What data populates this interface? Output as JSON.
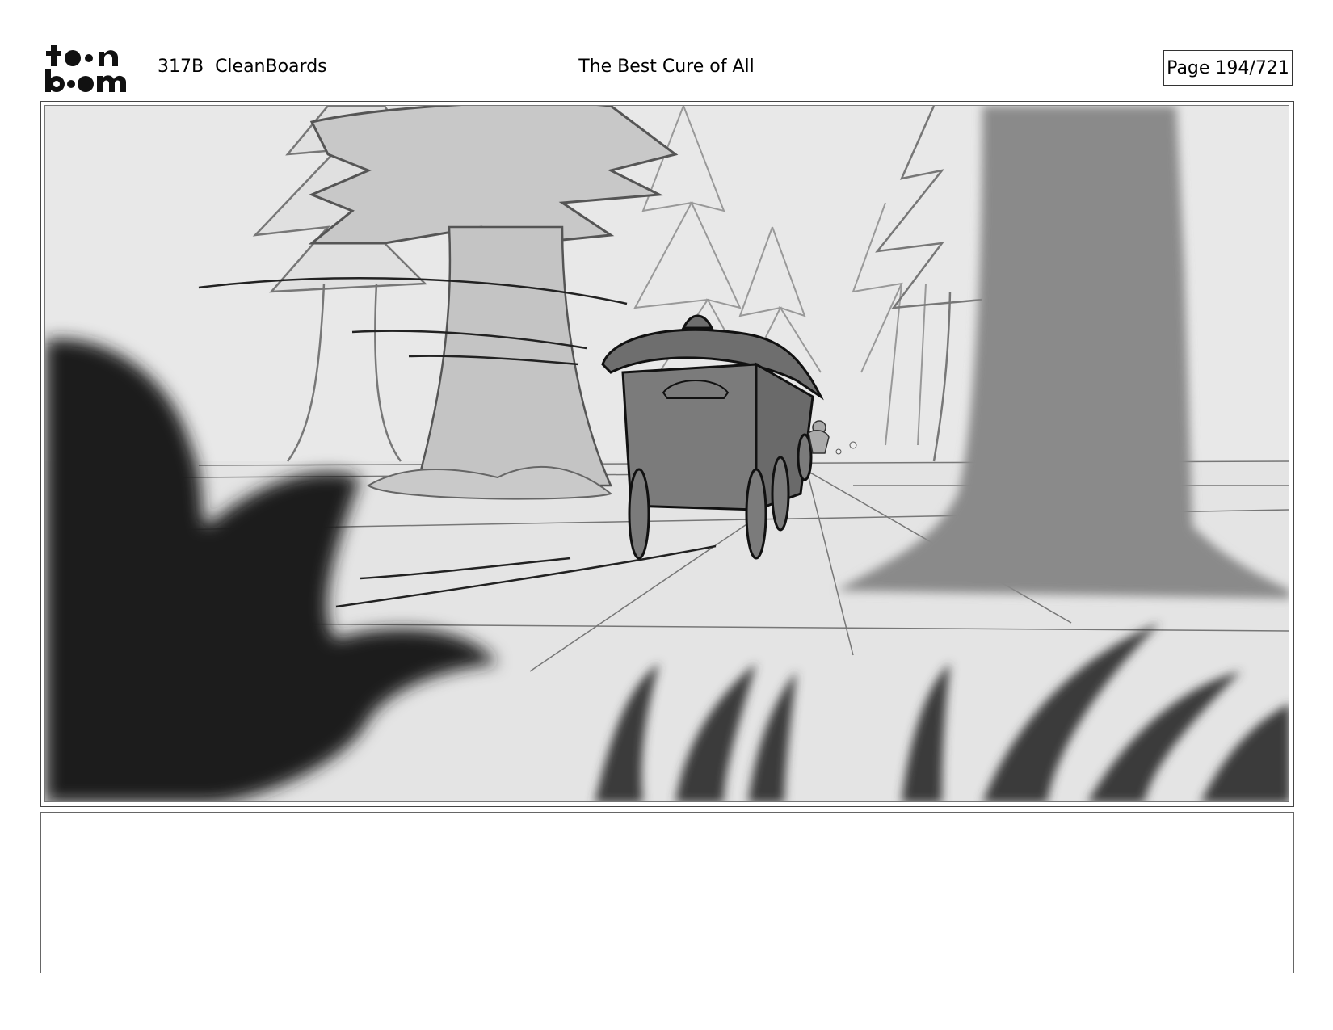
{
  "header": {
    "logo_text": "toon boom",
    "scene_label": "317B  CleanBoards",
    "title": "The Best Cure of All",
    "page_counter": "Page 194/721"
  },
  "panel": {
    "description_hidden": ""
  },
  "notes": {
    "text": ""
  }
}
